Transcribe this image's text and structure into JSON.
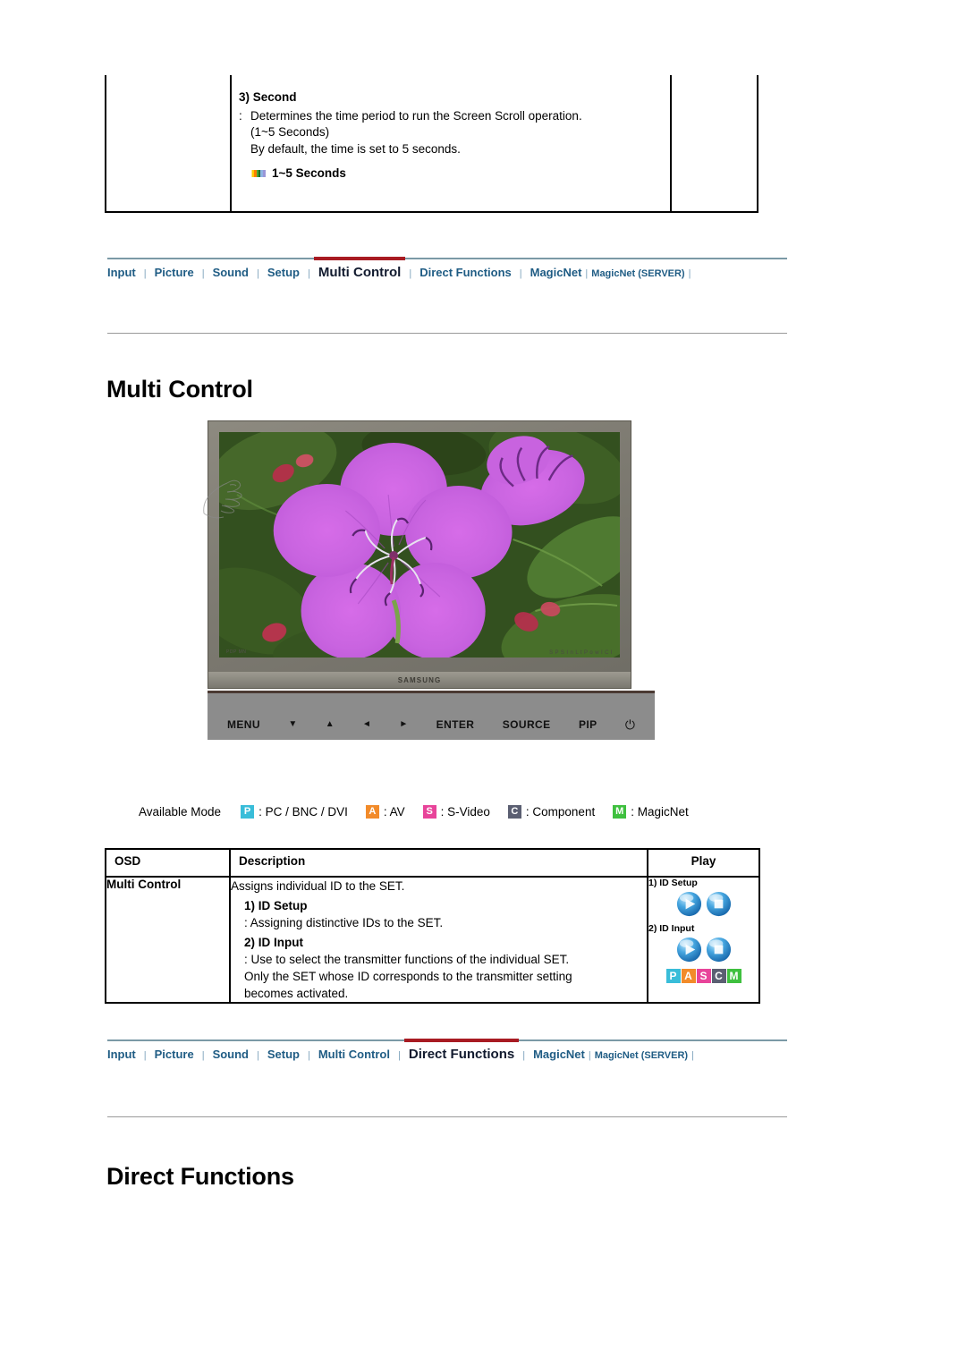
{
  "top_table": {
    "heading": "3) Second",
    "colon": ":",
    "line1": "Determines the time period to run the Screen Scroll operation.",
    "line2": "(1~5 Seconds)",
    "line3": "By default, the time is set to 5 seconds.",
    "note": "1~5 Seconds"
  },
  "nav1": {
    "items": [
      {
        "label": "Input",
        "active": false
      },
      {
        "label": "Picture",
        "active": false
      },
      {
        "label": "Sound",
        "active": false
      },
      {
        "label": "Setup",
        "active": false
      },
      {
        "label": "Multi Control",
        "active": true
      },
      {
        "label": "Direct Functions",
        "active": false
      },
      {
        "label": "MagicNet",
        "active": false
      },
      {
        "label": "MagicNet (SERVER)",
        "active": false
      }
    ],
    "separator": "|"
  },
  "nav2": {
    "items": [
      {
        "label": "Input",
        "active": false
      },
      {
        "label": "Picture",
        "active": false
      },
      {
        "label": "Sound",
        "active": false
      },
      {
        "label": "Setup",
        "active": false
      },
      {
        "label": "Multi Control",
        "active": false
      },
      {
        "label": "Direct Functions",
        "active": true
      },
      {
        "label": "MagicNet",
        "active": false
      },
      {
        "label": "MagicNet (SERVER)",
        "active": false
      }
    ],
    "separator": "|"
  },
  "headings": {
    "multi_control": "Multi Control",
    "direct_functions": "Direct Functions"
  },
  "monitor": {
    "brand": "SAMSUNG",
    "screen_badge_left": "PDP  MN",
    "screen_badge_right": "S  P  S  I  n  L  t  P  o  w  I  C  I",
    "controls": [
      {
        "name": "menu-button",
        "label": "MENU"
      },
      {
        "name": "down-arrow-button",
        "label": "▼"
      },
      {
        "name": "up-arrow-button",
        "label": "▲"
      },
      {
        "name": "left-arrow-button",
        "label": "◄"
      },
      {
        "name": "right-arrow-button",
        "label": "►"
      },
      {
        "name": "enter-button",
        "label": "ENTER"
      },
      {
        "name": "source-button",
        "label": "SOURCE"
      },
      {
        "name": "pip-button",
        "label": "PIP"
      },
      {
        "name": "power-button",
        "label": "⏻"
      }
    ]
  },
  "available_mode": {
    "label": "Available Mode",
    "modes": [
      {
        "badge": "P",
        "color": "#39bdd9",
        "text": ": PC / BNC / DVI"
      },
      {
        "badge": "A",
        "color": "#f28b2a",
        "text": ": AV"
      },
      {
        "badge": "S",
        "color": "#e8449a",
        "text": ": S-Video"
      },
      {
        "badge": "C",
        "color": "#5b5f72",
        "text": ": Component"
      },
      {
        "badge": "M",
        "color": "#3fc03f",
        "text": ": MagicNet"
      }
    ]
  },
  "osd_table": {
    "headers": {
      "osd": "OSD",
      "description": "Description",
      "play": "Play"
    },
    "row": {
      "osd": "Multi Control",
      "desc_intro": "Assigns individual ID to the SET.",
      "sub1_title": "1) ID Setup",
      "sub1_body": ": Assigning distinctive IDs to the SET.",
      "sub2_title": "2) ID Input",
      "sub2_line1": ": Use to select the transmitter functions of the individual SET.",
      "sub2_line2": "Only the SET whose ID corresponds to the transmitter setting",
      "sub2_line3": "becomes activated.",
      "play_caption_1": "1) ID Setup",
      "play_caption_2": "2) ID Input",
      "pascm": [
        {
          "badge": "P",
          "color": "#39bdd9"
        },
        {
          "badge": "A",
          "color": "#f28b2a"
        },
        {
          "badge": "S",
          "color": "#e8449a"
        },
        {
          "badge": "C",
          "color": "#5b5f72"
        },
        {
          "badge": "M",
          "color": "#3fc03f"
        }
      ]
    }
  }
}
